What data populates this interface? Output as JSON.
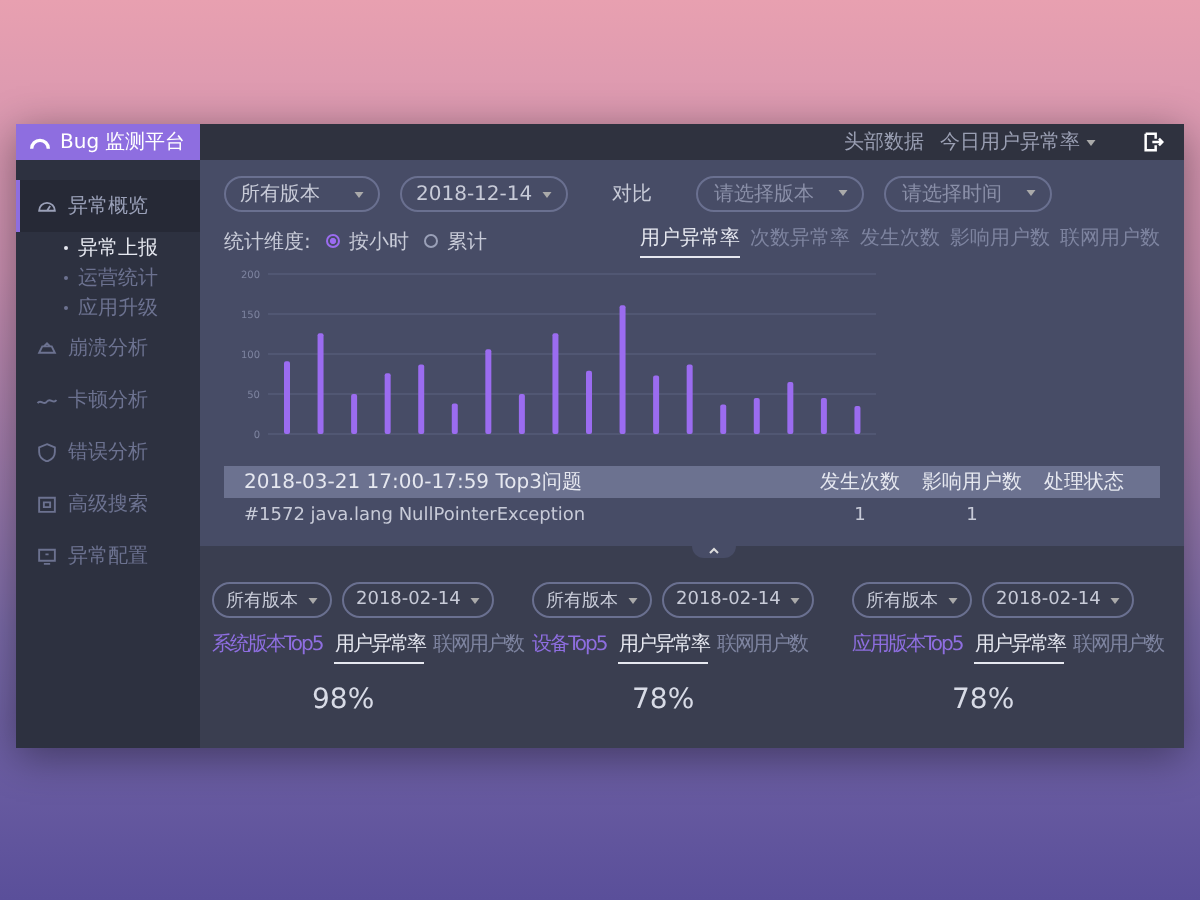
{
  "app": {
    "title": "Bug 监测平台"
  },
  "topbar": {
    "label": "头部数据",
    "menu": "今日用户异常率"
  },
  "sidebar": {
    "items": [
      {
        "label": "异常概览",
        "selected": true,
        "children": [
          {
            "label": "异常上报",
            "selected": true
          },
          {
            "label": "运营统计",
            "selected": false
          },
          {
            "label": "应用升级",
            "selected": false
          }
        ]
      },
      {
        "label": "崩溃分析",
        "selected": false
      },
      {
        "label": "卡顿分析",
        "selected": false
      },
      {
        "label": "错误分析",
        "selected": false
      },
      {
        "label": "高级搜索",
        "selected": false
      },
      {
        "label": "异常配置",
        "selected": false
      }
    ]
  },
  "filters": {
    "version": "所有版本",
    "date": "2018-12-14",
    "compare_label": "对比",
    "compare_version": {
      "placeholder": "请选择版本"
    },
    "compare_time": {
      "placeholder": "请选择时间"
    }
  },
  "dimension": {
    "label": "统计维度:",
    "options": [
      {
        "label": "按小时",
        "selected": true
      },
      {
        "label": "累计",
        "selected": false
      }
    ]
  },
  "chart_tabs": [
    {
      "label": "用户异常率",
      "selected": true
    },
    {
      "label": "次数异常率",
      "selected": false
    },
    {
      "label": "发生次数",
      "selected": false
    },
    {
      "label": "影响用户数",
      "selected": false
    },
    {
      "label": "联网用户数",
      "selected": false
    }
  ],
  "chart_data": {
    "type": "bar",
    "ylim": [
      0,
      200
    ],
    "yticks": [
      0,
      50,
      100,
      150,
      200
    ],
    "grid": true,
    "series": [
      {
        "color": "#9b6cf0",
        "values": [
          91,
          126,
          50,
          76,
          87,
          38,
          106,
          50,
          126,
          79,
          161,
          73,
          87,
          37,
          45,
          65,
          45,
          35
        ]
      }
    ]
  },
  "table": {
    "title": "2018-03-21  17:00-17:59  Top3问题",
    "columns": [
      "发生次数",
      "影响用户数",
      "处理状态"
    ],
    "rows": [
      {
        "issue": "#1572 java.lang NullPointerException",
        "cells": [
          "1",
          "1"
        ]
      }
    ]
  },
  "panels": [
    {
      "version": "所有版本",
      "date": "2018-02-14",
      "link": "系统版本Top5",
      "tabs": [
        {
          "label": "用户异常率",
          "selected": true
        },
        {
          "label": "联网用户数",
          "selected": false
        }
      ],
      "value": "98%"
    },
    {
      "version": "所有版本",
      "date": "2018-02-14",
      "link": "设备Top5",
      "tabs": [
        {
          "label": "用户异常率",
          "selected": true
        },
        {
          "label": "联网用户数",
          "selected": false
        }
      ],
      "value": "78%"
    },
    {
      "version": "所有版本",
      "date": "2018-02-14",
      "link": "应用版本Top5",
      "tabs": [
        {
          "label": "用户异常率",
          "selected": true
        },
        {
          "label": "联网用户数",
          "selected": false
        }
      ],
      "value": "78%"
    }
  ]
}
